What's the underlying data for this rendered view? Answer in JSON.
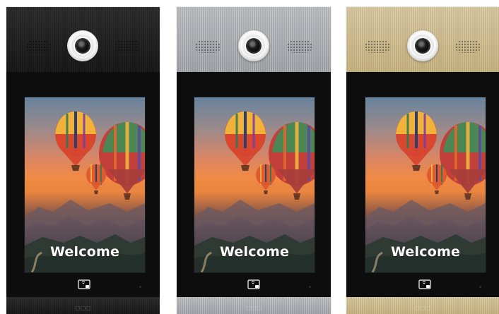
{
  "panels": [
    {
      "finish": "black",
      "welcome": "Welcome"
    },
    {
      "finish": "silver",
      "welcome": "Welcome"
    },
    {
      "finish": "gold",
      "welcome": "Welcome"
    }
  ],
  "icons": {
    "camera": "camera-icon",
    "card": "access-card-icon"
  },
  "colors": {
    "panel_black": "#161616",
    "panel_silver": "#a8acb0",
    "panel_gold": "#cdb886",
    "screen_sunset": "#f08a45",
    "balloon_main": "#d9472f"
  }
}
